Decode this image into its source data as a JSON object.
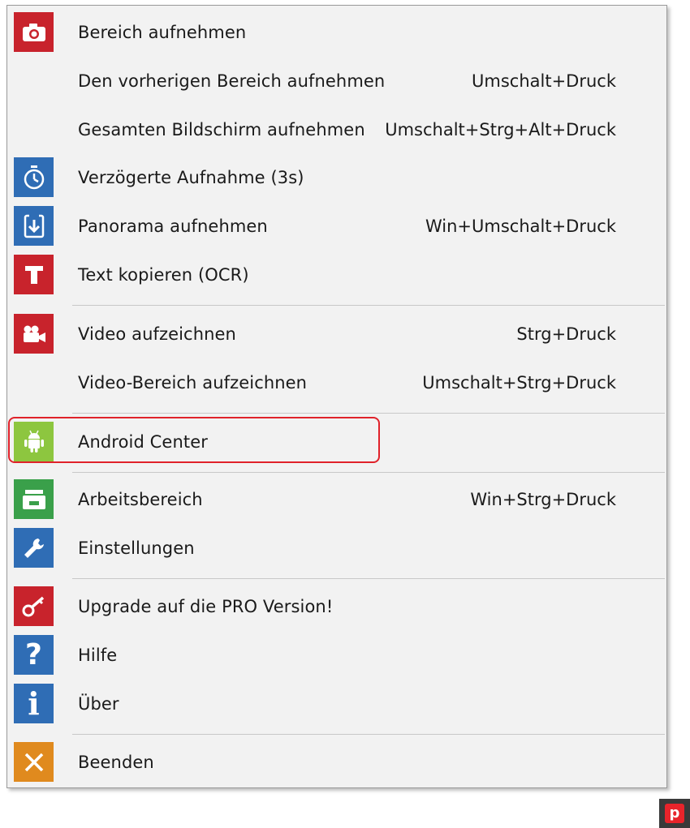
{
  "menu": {
    "items": [
      {
        "label": "Bereich aufnehmen",
        "shortcut": "",
        "icon": "camera-icon",
        "color": "#c8232c"
      },
      {
        "label": "Den vorherigen Bereich aufnehmen",
        "shortcut": "Umschalt+Druck",
        "icon": "",
        "color": ""
      },
      {
        "label": "Gesamten Bildschirm aufnehmen",
        "shortcut": "Umschalt+Strg+Alt+Druck",
        "icon": "",
        "color": ""
      },
      {
        "label": "Verzögerte Aufnahme (3s)",
        "shortcut": "",
        "icon": "timer-icon",
        "color": "#2f6db5"
      },
      {
        "label": "Panorama aufnehmen",
        "shortcut": "Win+Umschalt+Druck",
        "icon": "panorama-icon",
        "color": "#2f6db5"
      },
      {
        "label": "Text kopieren (OCR)",
        "shortcut": "",
        "icon": "text-t-icon",
        "color": "#c8232c"
      },
      {
        "label": "Video aufzeichnen",
        "shortcut": "Strg+Druck",
        "icon": "video-camera-icon",
        "color": "#c8232c"
      },
      {
        "label": "Video-Bereich aufzeichnen",
        "shortcut": "Umschalt+Strg+Druck",
        "icon": "",
        "color": ""
      },
      {
        "label": "Android Center",
        "shortcut": "",
        "icon": "android-icon",
        "color": "#8dc63f"
      },
      {
        "label": "Arbeitsbereich",
        "shortcut": "Win+Strg+Druck",
        "icon": "workspace-icon",
        "color": "#3aa04a"
      },
      {
        "label": "Einstellungen",
        "shortcut": "",
        "icon": "wrench-icon",
        "color": "#2f6db5"
      },
      {
        "label": "Upgrade auf die PRO Version!",
        "shortcut": "",
        "icon": "key-icon",
        "color": "#c8232c"
      },
      {
        "label": "Hilfe",
        "shortcut": "",
        "icon": "help-icon",
        "color": "#2f6db5"
      },
      {
        "label": "Über",
        "shortcut": "",
        "icon": "info-icon",
        "color": "#2f6db5"
      },
      {
        "label": "Beenden",
        "shortcut": "",
        "icon": "close-icon",
        "color": "#e08a1e"
      }
    ]
  },
  "highlight_color": "#e0222a",
  "tray": {
    "icon": "picpick-tray-icon",
    "letter": "p"
  }
}
